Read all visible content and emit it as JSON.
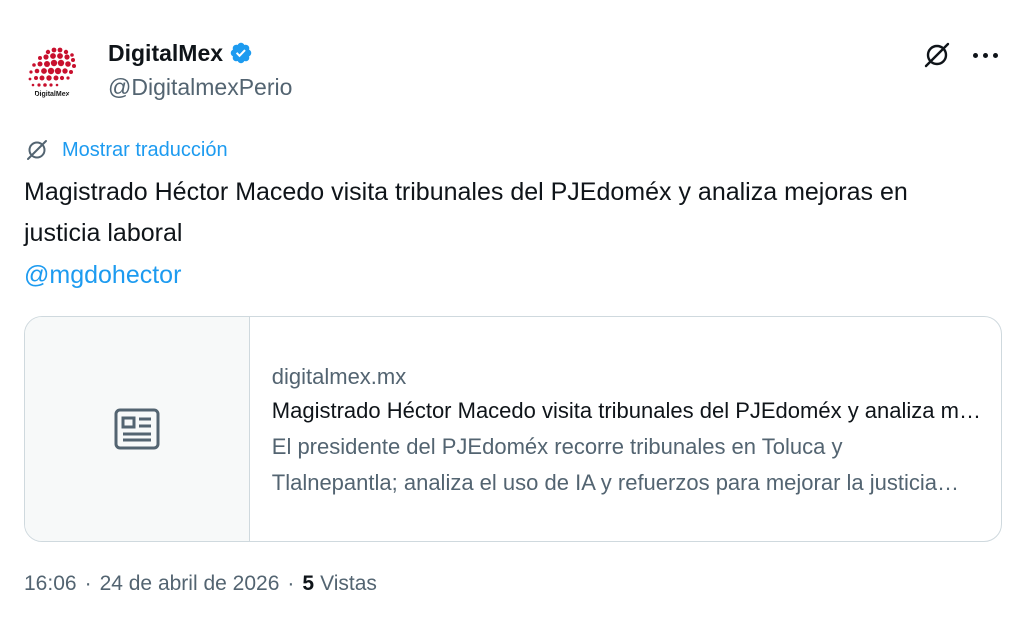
{
  "author": {
    "display_name": "DigitalMex",
    "handle": "@DigitalmexPerio",
    "avatar_label": "DigitalMex",
    "verified": true
  },
  "actions": {
    "translate_icon": "translate-off-icon",
    "more_icon": "more-icon"
  },
  "translation": {
    "label": "Mostrar traducción"
  },
  "tweet": {
    "text": "Magistrado Héctor Macedo visita tribunales del PJEdoméx y analiza mejoras en justicia laboral",
    "mention": "@mgdohector"
  },
  "card": {
    "domain": "digitalmex.mx",
    "title": "Magistrado Héctor Macedo visita tribunales del PJEdoméx y analiza mejoras en justicia laboral",
    "description": "El presidente del PJEdoméx recorre tribunales en Toluca y Tlalnepantla; analiza el uso de IA y refuerzos para mejorar la justicia laboral",
    "media_icon": "article-icon"
  },
  "meta": {
    "time": "16:06",
    "date": "24 de abril de 2026",
    "views_count": "5",
    "views_label": "Vistas"
  },
  "colors": {
    "accent": "#1d9bf0",
    "secondary_text": "#536471",
    "primary_text": "#0f1419",
    "border": "#cfd9de",
    "logo_red": "#c8102e"
  }
}
